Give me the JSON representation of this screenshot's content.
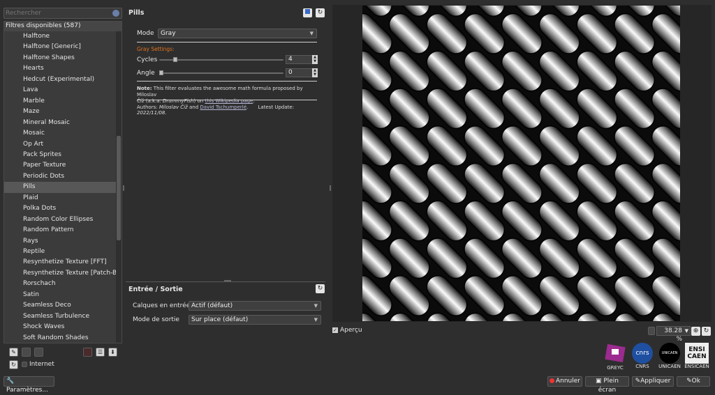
{
  "search": {
    "placeholder": "Rechercher"
  },
  "filters": {
    "header": "Filtres disponibles (587)",
    "items": [
      "Halftone",
      "Halftone [Generic]",
      "Halftone Shapes",
      "Hearts",
      "Hedcut (Experimental)",
      "Lava",
      "Marble",
      "Maze",
      "Mineral Mosaic",
      "Mosaic",
      "Op Art",
      "Pack Sprites",
      "Paper Texture",
      "Periodic Dots",
      "Pills",
      "Plaid",
      "Polka Dots",
      "Random Color Ellipses",
      "Random Pattern",
      "Rays",
      "Reptile",
      "Resynthetize Texture [FFT]",
      "Resynthetize Texture [Patch-Based]",
      "Rorschach",
      "Satin",
      "Seamless Deco",
      "Seamless Turbulence",
      "Shock Waves",
      "Soft Random Shades"
    ],
    "selected_index": 14
  },
  "left_toolbar": {
    "internet_label": "Internet",
    "params_label": "Paramètres..."
  },
  "filter_panel": {
    "title": "Pills",
    "mode_label": "Mode",
    "mode_value": "Gray",
    "section_title": "Gray Settings:",
    "cycles_label": "Cycles",
    "cycles_value": "4",
    "angle_label": "Angle",
    "angle_value": "0",
    "note_bold": "Note:",
    "note_text1": " This filter evaluates the awesome math formula proposed by Miloslav",
    "note_text2a": "Číž (a.k.a. ",
    "note_italic": "DrummyFish",
    "note_text2b": ") on ",
    "note_link": "this Wikipedia page",
    "note_end": ".",
    "authors_prefix": "Authors: ",
    "author1": "Miloslav Číž",
    "authors_and": " and ",
    "author2": "David Tschumperlé",
    "authors_dot": ".",
    "update_label": "Latest Update: ",
    "update_value": "2022/11/08."
  },
  "io_panel": {
    "title": "Entrée / Sortie",
    "input_label": "Calques en entrée",
    "input_value": "Actif (défaut)",
    "output_label": "Mode de sortie",
    "output_value": "Sur place (défaut)"
  },
  "preview": {
    "apercu_label": "Aperçu",
    "zoom": "38.28 %"
  },
  "logos": [
    "GREYC",
    "CNRS",
    "UNICAEN",
    "ENSICAEN"
  ],
  "logo_texts": {
    "cnrs": "cnrs",
    "unicaen": "UNICAEN",
    "ensi": "ENSI",
    "caen": "CAEN"
  },
  "buttons": {
    "annuler": "Annuler",
    "plein_ecran": "Plein écran",
    "appliquer": "Appliquer",
    "ok": "Ok"
  }
}
